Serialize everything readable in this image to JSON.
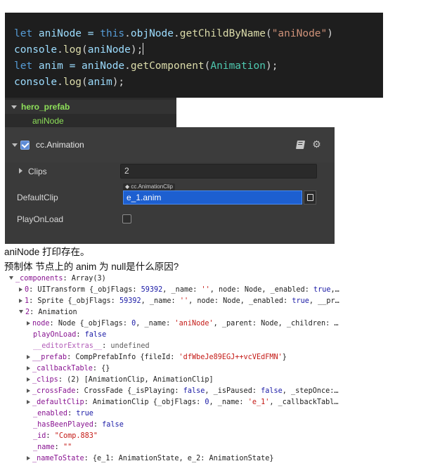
{
  "code": {
    "lines": [
      [
        {
          "t": "let",
          "c": "kw"
        },
        {
          "t": " aniNode = ",
          "c": "var"
        },
        {
          "t": "this",
          "c": "kw"
        },
        {
          "t": ".",
          "c": ""
        },
        {
          "t": "objNode",
          "c": "var"
        },
        {
          "t": ".",
          "c": ""
        },
        {
          "t": "getChildByName",
          "c": "fn"
        },
        {
          "t": "(",
          "c": ""
        },
        {
          "t": "\"aniNode\"",
          "c": "str"
        },
        {
          "t": ")",
          "c": ""
        }
      ],
      [
        {
          "t": "console",
          "c": "var"
        },
        {
          "t": ".",
          "c": ""
        },
        {
          "t": "log",
          "c": "fn"
        },
        {
          "t": "(",
          "c": ""
        },
        {
          "t": "aniNode",
          "c": "var"
        },
        {
          "t": ");",
          "c": ""
        },
        {
          "t": "|caret|",
          "c": "caret"
        }
      ],
      [
        {
          "t": "let",
          "c": "kw"
        },
        {
          "t": " anim = ",
          "c": "var"
        },
        {
          "t": "aniNode",
          "c": "var"
        },
        {
          "t": ".",
          "c": ""
        },
        {
          "t": "getComponent",
          "c": "fn"
        },
        {
          "t": "(",
          "c": ""
        },
        {
          "t": "Animation",
          "c": "cls"
        },
        {
          "t": ");",
          "c": ""
        }
      ],
      [
        {
          "t": "console",
          "c": "var"
        },
        {
          "t": ".",
          "c": ""
        },
        {
          "t": "log",
          "c": "fn"
        },
        {
          "t": "(",
          "c": ""
        },
        {
          "t": "anim",
          "c": "var"
        },
        {
          "t": ");",
          "c": ""
        }
      ]
    ]
  },
  "hierarchy": {
    "root": "hero_prefab",
    "child": "aniNode"
  },
  "inspector": {
    "component_title": "cc.Animation",
    "clips_label": "Clips",
    "clips_value": "2",
    "default_clip_label": "DefaultClip",
    "asset_type": "cc.AnimationClip",
    "default_clip_value": "e_1.anim",
    "play_on_load_label": "PlayOnLoad"
  },
  "question": {
    "line1": "aniNode 打印存在。",
    "line2": "预制体 节点上的 anim 为 null是什么原因?"
  },
  "console": {
    "rows": [
      {
        "x": 13,
        "tri": "down",
        "parts": [
          {
            "t": "_components",
            "c": "k"
          },
          {
            "t": ": Array(3)",
            "c": ""
          }
        ]
      },
      {
        "x": 27,
        "tri": "right",
        "parts": [
          {
            "t": "0",
            "c": "k"
          },
          {
            "t": ": UITransform {_objFlags: ",
            "c": ""
          },
          {
            "t": "59392",
            "c": "b"
          },
          {
            "t": ", _name: ",
            "c": ""
          },
          {
            "t": "''",
            "c": "s"
          },
          {
            "t": ", node: Node, _enabled: ",
            "c": ""
          },
          {
            "t": "true",
            "c": "b"
          },
          {
            "t": ",…",
            "c": ""
          }
        ]
      },
      {
        "x": 27,
        "tri": "right",
        "parts": [
          {
            "t": "1",
            "c": "k"
          },
          {
            "t": ": Sprite {_objFlags: ",
            "c": ""
          },
          {
            "t": "59392",
            "c": "b"
          },
          {
            "t": ", _name: ",
            "c": ""
          },
          {
            "t": "''",
            "c": "s"
          },
          {
            "t": ", node: Node, _enabled: ",
            "c": ""
          },
          {
            "t": "true",
            "c": "b"
          },
          {
            "t": ", __pr…",
            "c": ""
          }
        ]
      },
      {
        "x": 27,
        "tri": "down",
        "parts": [
          {
            "t": "2",
            "c": "k"
          },
          {
            "t": ": Animation",
            "c": ""
          }
        ]
      },
      {
        "x": 38,
        "tri": "right",
        "parts": [
          {
            "t": "node",
            "c": "k"
          },
          {
            "t": ": Node {_objFlags: ",
            "c": ""
          },
          {
            "t": "0",
            "c": "b"
          },
          {
            "t": ", _name: ",
            "c": ""
          },
          {
            "t": "'aniNode'",
            "c": "s"
          },
          {
            "t": ", _parent: Node, _children: …",
            "c": ""
          }
        ]
      },
      {
        "x": 47,
        "tri": "",
        "parts": [
          {
            "t": "playOnLoad",
            "c": "k"
          },
          {
            "t": ": ",
            "c": ""
          },
          {
            "t": "false",
            "c": "b"
          }
        ]
      },
      {
        "x": 47,
        "tri": "",
        "parts": [
          {
            "t": "__editorExtras__",
            "c": "kd"
          },
          {
            "t": ": ",
            "c": ""
          },
          {
            "t": "undefined",
            "c": "g"
          }
        ]
      },
      {
        "x": 38,
        "tri": "right",
        "parts": [
          {
            "t": "__prefab",
            "c": "k"
          },
          {
            "t": ": CompPrefabInfo {fileId: ",
            "c": ""
          },
          {
            "t": "'dfWbeJe89EGJ++vcVEdFMN'",
            "c": "s"
          },
          {
            "t": "}",
            "c": ""
          }
        ]
      },
      {
        "x": 38,
        "tri": "right",
        "parts": [
          {
            "t": "_callbackTable",
            "c": "k"
          },
          {
            "t": ": {}",
            "c": ""
          }
        ]
      },
      {
        "x": 38,
        "tri": "right",
        "parts": [
          {
            "t": "_clips",
            "c": "k"
          },
          {
            "t": ": (2) [AnimationClip, AnimationClip]",
            "c": ""
          }
        ]
      },
      {
        "x": 38,
        "tri": "right",
        "parts": [
          {
            "t": "_crossFade",
            "c": "k"
          },
          {
            "t": ": CrossFade {_isPlaying: ",
            "c": ""
          },
          {
            "t": "false",
            "c": "b"
          },
          {
            "t": ", _isPaused: ",
            "c": ""
          },
          {
            "t": "false",
            "c": "b"
          },
          {
            "t": ", _stepOnce:…",
            "c": ""
          }
        ]
      },
      {
        "x": 38,
        "tri": "right",
        "parts": [
          {
            "t": "_defaultClip",
            "c": "k"
          },
          {
            "t": ": AnimationClip {_objFlags: ",
            "c": ""
          },
          {
            "t": "0",
            "c": "b"
          },
          {
            "t": ", _name: ",
            "c": ""
          },
          {
            "t": "'e_1'",
            "c": "s"
          },
          {
            "t": ", _callbackTabl…",
            "c": ""
          }
        ]
      },
      {
        "x": 47,
        "tri": "",
        "parts": [
          {
            "t": "_enabled",
            "c": "k"
          },
          {
            "t": ": ",
            "c": ""
          },
          {
            "t": "true",
            "c": "b"
          }
        ]
      },
      {
        "x": 47,
        "tri": "",
        "parts": [
          {
            "t": "_hasBeenPlayed",
            "c": "k"
          },
          {
            "t": ": ",
            "c": ""
          },
          {
            "t": "false",
            "c": "b"
          }
        ]
      },
      {
        "x": 47,
        "tri": "",
        "parts": [
          {
            "t": "_id",
            "c": "k"
          },
          {
            "t": ": ",
            "c": ""
          },
          {
            "t": "\"Comp.883\"",
            "c": "s"
          }
        ]
      },
      {
        "x": 47,
        "tri": "",
        "parts": [
          {
            "t": "_name",
            "c": "k"
          },
          {
            "t": ": ",
            "c": ""
          },
          {
            "t": "\"\"",
            "c": "s"
          }
        ]
      },
      {
        "x": 38,
        "tri": "right",
        "parts": [
          {
            "t": "_nameToState",
            "c": "k"
          },
          {
            "t": ": {e_1: AnimationState, e_2: AnimationState}",
            "c": ""
          }
        ]
      }
    ]
  }
}
